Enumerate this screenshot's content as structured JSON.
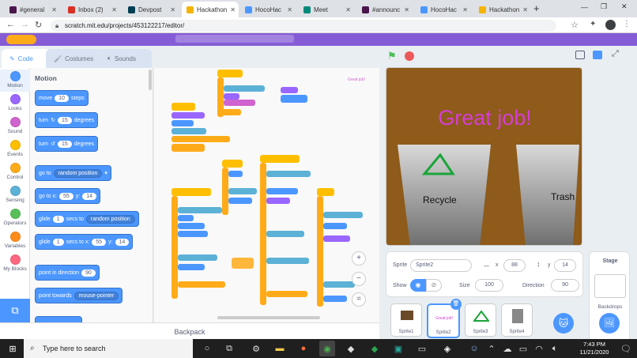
{
  "browser": {
    "tabs": [
      {
        "label": "#general",
        "color": "#4a154b"
      },
      {
        "label": "Inbox (2)",
        "color": "#d93025"
      },
      {
        "label": "Devpost",
        "color": "#003e54"
      },
      {
        "label": "Hackathon",
        "color": "#f4b400"
      },
      {
        "label": "HocoHac",
        "color": "#4c97ff"
      },
      {
        "label": "Meet",
        "color": "#00897b"
      },
      {
        "label": "#announc",
        "color": "#4a154b"
      },
      {
        "label": "HocoHac",
        "color": "#4c97ff"
      },
      {
        "label": "Hackathon",
        "color": "#f4b400"
      }
    ],
    "new_tab": "+",
    "url": "scratch.mit.edu/projects/453122217/editor/"
  },
  "editor_tabs": {
    "code": "Code",
    "costumes": "Costumes",
    "sounds": "Sounds"
  },
  "categories": [
    {
      "label": "Motion",
      "color": "#4c97ff"
    },
    {
      "label": "Looks",
      "color": "#9966ff"
    },
    {
      "label": "Sound",
      "color": "#cf63cf"
    },
    {
      "label": "Events",
      "color": "#ffbf00"
    },
    {
      "label": "Control",
      "color": "#ffab19"
    },
    {
      "label": "Sensing",
      "color": "#5cb1d6"
    },
    {
      "label": "Operators",
      "color": "#59c059"
    },
    {
      "label": "Variables",
      "color": "#ff8c1a"
    },
    {
      "label": "My Blocks",
      "color": "#ff6680"
    }
  ],
  "palette": {
    "heading": "Motion",
    "move": {
      "pre": "move",
      "val": "10",
      "post": "steps"
    },
    "turn_right": {
      "pre": "turn",
      "val": "15",
      "post": "degrees"
    },
    "turn_left": {
      "pre": "turn",
      "val": "15",
      "post": "degrees"
    },
    "goto": {
      "pre": "go to",
      "dd": "random position"
    },
    "goto_xy": {
      "pre": "go to x:",
      "x": "55",
      "ylab": "y:",
      "y": "14"
    },
    "glide_random": {
      "pre": "glide",
      "val": "1",
      "mid": "secs to",
      "dd": "random position"
    },
    "glide_xy": {
      "pre": "glide",
      "val": "1",
      "mid": "secs to x:",
      "x": "55",
      "ylab": "y:",
      "y": "14"
    },
    "point_dir": {
      "pre": "point in direction",
      "val": "90"
    },
    "point_towards": {
      "pre": "point towards",
      "dd": "mouse-pointer"
    }
  },
  "code_area": {
    "comment_text": "Great job!"
  },
  "backpack": "Backpack",
  "stage": {
    "message": "Great job!",
    "recycle": "Recycle",
    "trash": "Trash"
  },
  "sprite_info": {
    "sprite_label": "Sprite",
    "sprite_name": "Sprite2",
    "x_label": "x",
    "x": "88",
    "y_label": "y",
    "y": "14",
    "show_label": "Show",
    "size_label": "Size",
    "size": "100",
    "direction_label": "Direction",
    "direction": "90"
  },
  "sprites": [
    {
      "name": "Sprite1"
    },
    {
      "name": "Sprite2",
      "thumb_text": "Great job!"
    },
    {
      "name": "Sprite3"
    },
    {
      "name": "Sprite4"
    }
  ],
  "stage_panel": {
    "title": "Stage",
    "backdrops": "Backdrops"
  },
  "taskbar": {
    "search_placeholder": "Type here to search",
    "time": "7:43 PM",
    "date": "11/21/2020"
  }
}
